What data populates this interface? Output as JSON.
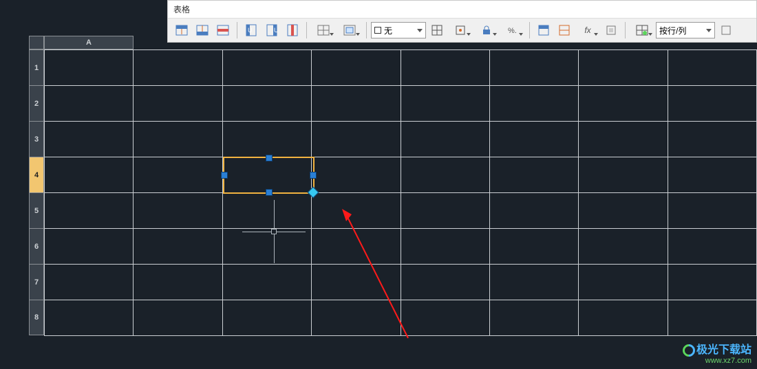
{
  "toolbar": {
    "title": "表格",
    "group_row": {
      "insert_above": "在上方插入行",
      "insert_below": "在下方插入行",
      "delete_row": "删除行"
    },
    "group_col": {
      "insert_left": "在左侧插入列",
      "insert_right": "在右侧插入列",
      "delete_col": "删除列"
    },
    "merge": {
      "merge_cells": "合并单元格",
      "unmerge": "取消合并"
    },
    "border_style": {
      "selected": "无",
      "prefix": "□"
    },
    "border_tools": {
      "all_borders": "所有边框",
      "align": "对齐",
      "lock": "锁定",
      "format": "数据格式"
    },
    "cell_tools": {
      "cell_style": "单元格样式",
      "match_cell": "匹配单元格",
      "formula": "fx",
      "field": "字段",
      "link": "链接"
    },
    "by_rowcol": {
      "label": "按行/列"
    }
  },
  "grid": {
    "col_header": "A",
    "row_headers": [
      "1",
      "2",
      "3",
      "4",
      "5",
      "6",
      "7",
      "8"
    ],
    "selected_row_index": 3,
    "columns": 8,
    "rows": 8,
    "selected_cell": {
      "row": 4,
      "col": 3
    }
  },
  "watermark": {
    "line1": "极光下载站",
    "line2": "www.xz7.com"
  }
}
